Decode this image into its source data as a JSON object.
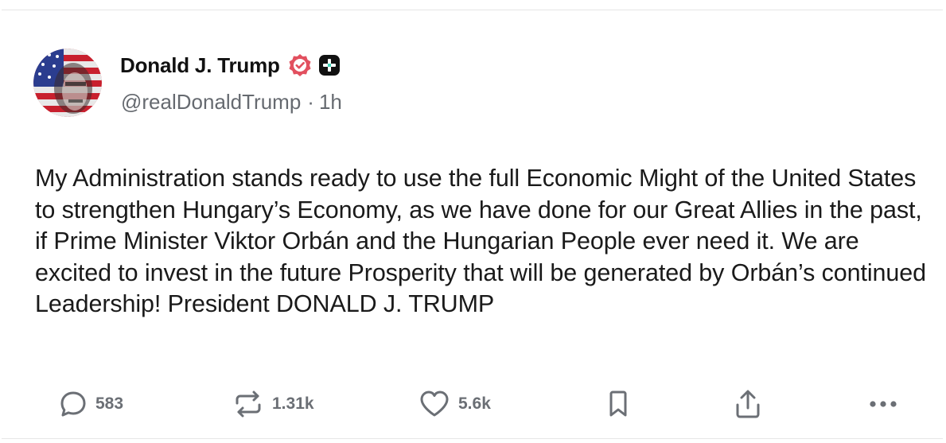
{
  "post": {
    "author_name": "Donald J. Trump",
    "handle": "@realDonaldTrump",
    "separator": "·",
    "time": "1h",
    "body": "My Administration stands ready to use the full Economic Might of the United States to strengthen Hungary’s Economy, as we have done for our Great Allies in the past, if Prime Minister Viktor Orbán and the Hungarian People ever need it. We are excited to invest in the future Prosperity that will be generated by Orbán’s continued Leadership! President DONALD J. TRUMP"
  },
  "actions": {
    "replies": "583",
    "retruths": "1.31k",
    "likes": "5.6k"
  },
  "icons": {
    "verified": "verified-badge-icon",
    "plus": "plus-badge-icon",
    "reply": "speech-bubble-icon",
    "retruth": "repost-arrows-icon",
    "like": "heart-icon",
    "bookmark": "bookmark-icon",
    "share": "share-upload-icon",
    "more": "more-dots-icon"
  },
  "colors": {
    "verified_badge": "#e2505f",
    "text": "#1a1a1a",
    "muted": "#6b6f75"
  }
}
